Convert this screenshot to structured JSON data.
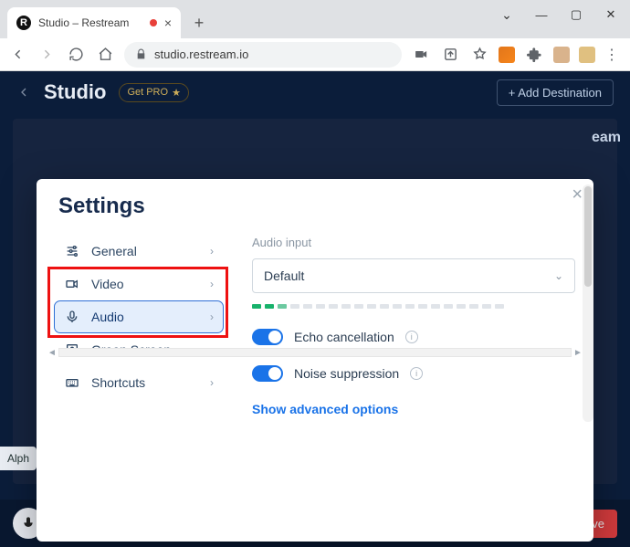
{
  "browser": {
    "tab_title": "Studio – Restream",
    "url": "studio.restream.io"
  },
  "studio": {
    "title": "Studio",
    "pro_label": "Get PRO",
    "add_destination": "+ Add Destination",
    "go_live": "Live",
    "alpha": "Alph",
    "eam_fragment": "eam"
  },
  "settings": {
    "title": "Settings",
    "nav": {
      "general": "General",
      "video": "Video",
      "audio": "Audio",
      "green_screen": "Green Screen",
      "shortcuts": "Shortcuts"
    },
    "audio": {
      "input_label": "Audio input",
      "input_value": "Default",
      "echo_label": "Echo cancellation",
      "noise_label": "Noise suppression",
      "advanced": "Show advanced options"
    }
  }
}
